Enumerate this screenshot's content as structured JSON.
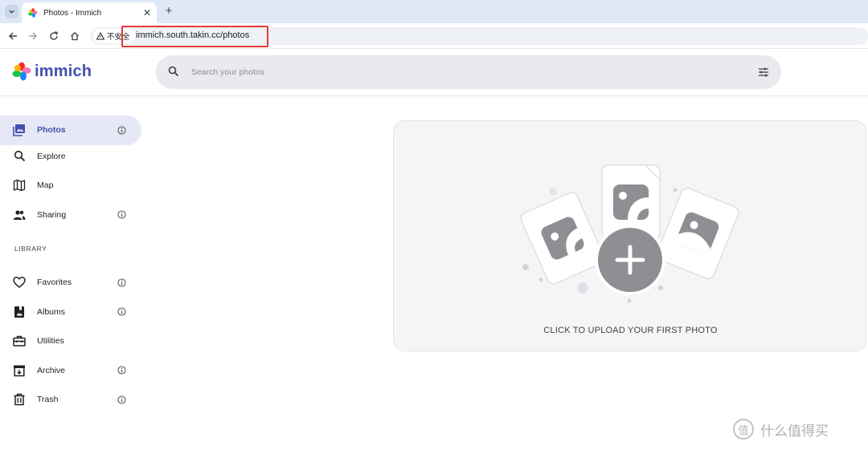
{
  "browser": {
    "tab_title": "Photos - Immich",
    "tab_close": "✕",
    "new_tab": "+",
    "security_label": "不安全",
    "url": "immich.south.takin.cc/photos"
  },
  "app": {
    "logo_text": "immich",
    "brand_color": "#4250af",
    "search_placeholder": "Search your photos"
  },
  "sidebar": {
    "items": [
      {
        "label": "Photos",
        "icon": "photos-icon",
        "active": true,
        "info": true
      },
      {
        "label": "Explore",
        "icon": "magnify-icon",
        "active": false,
        "info": false
      },
      {
        "label": "Map",
        "icon": "map-icon",
        "active": false,
        "info": false
      },
      {
        "label": "Sharing",
        "icon": "people-icon",
        "active": false,
        "info": true
      }
    ],
    "library_label": "LIBRARY",
    "library_items": [
      {
        "label": "Favorites",
        "icon": "heart-icon",
        "info": true
      },
      {
        "label": "Albums",
        "icon": "album-icon",
        "info": true
      },
      {
        "label": "Utilities",
        "icon": "toolbox-icon",
        "info": false
      },
      {
        "label": "Archive",
        "icon": "archive-icon",
        "info": true
      },
      {
        "label": "Trash",
        "icon": "trash-icon",
        "info": true
      }
    ]
  },
  "main": {
    "upload_caption": "CLICK TO UPLOAD YOUR FIRST PHOTO"
  },
  "watermark": {
    "badge": "值",
    "text": "什么值得买"
  }
}
